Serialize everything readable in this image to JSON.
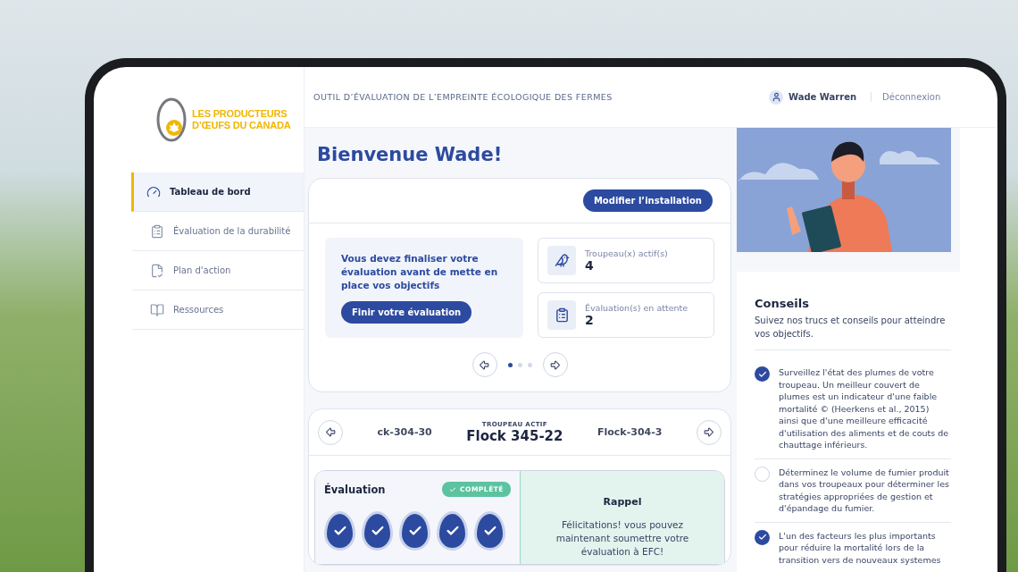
{
  "logo": {
    "line1": "LES PRODUCTEURS",
    "line2": "D’ŒUFS DU CANADA"
  },
  "sidebar": {
    "items": [
      {
        "label": "Tableau de bord",
        "selected": true
      },
      {
        "label": "Évaluation de la durabilité",
        "selected": false
      },
      {
        "label": "Plan d'action",
        "selected": false
      },
      {
        "label": "Ressources",
        "selected": false
      }
    ]
  },
  "header": {
    "title": "OUTIL D’ÉVALUATION DE L’EMPREINTE ÉCOLOGIQUE DES FERMES",
    "user": "Wade Warren",
    "logout": "Déconnexion"
  },
  "welcome": "Bienvenue Wade!",
  "summary": {
    "button": "Modifier l’installation",
    "message": "Vous devez finaliser votre évaluation avant de mette en place vos objectifs",
    "cta": "Finir votre évaluation",
    "stats": [
      {
        "label": "Troupeau(x) actif(s)",
        "value": "4"
      },
      {
        "label": "Évaluation(s) en attente",
        "value": "2"
      }
    ],
    "pages": [
      {
        "selected": true
      },
      {
        "selected": false
      },
      {
        "selected": false
      }
    ]
  },
  "flock": {
    "caption": "TROUPEAU ACTIF",
    "previous": "ck-304-30",
    "current": "Flock 345-22",
    "next": "Flock-304-3"
  },
  "evaluation": {
    "title": "Évaluation",
    "status": "COMPLÉTÉ",
    "steps": [
      {
        "done": true
      },
      {
        "done": true
      },
      {
        "done": true
      },
      {
        "done": true
      },
      {
        "done": true
      }
    ]
  },
  "reminder": {
    "title": "Rappel",
    "text": "Félicitations! vous pouvez maintenant soumettre votre évaluation à EFC!"
  },
  "tips": {
    "title": "Conseils",
    "subtitle": "Suivez nos trucs et conseils pour atteindre vos objectifs.",
    "items": [
      {
        "text": "Surveillez l'état des plumes de votre troupeau. Un meilleur couvert de plumes est un indicateur d'une faible mortalité © (Heerkens et al., 2015) ainsi que d'une meilleure efficacité d'utilisation des aliments et de couts de chauttage inférieurs.",
        "checked": true
      },
      {
        "text": "Déterminez le volume de fumier produit dans vos troupeaux pour déterminer les stratégies appropriées de gestion et d'épandage du fumier.",
        "checked": false
      },
      {
        "text": "L'un des facteurs les plus importants pour réduire la mortalité lors de la transition vers de nouveaux systemes",
        "checked": true
      }
    ]
  }
}
